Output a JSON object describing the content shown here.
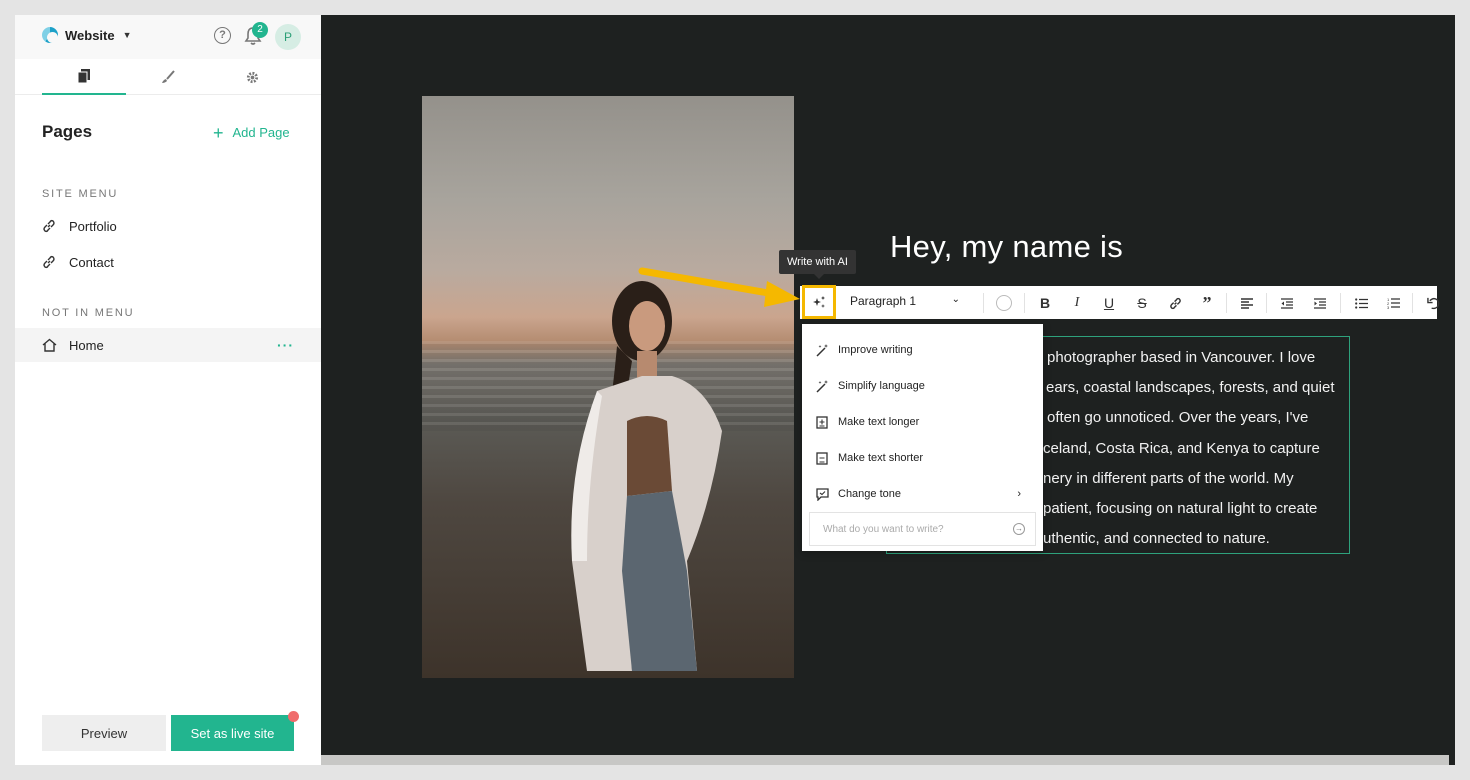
{
  "header": {
    "site_name": "Website",
    "notifications_count": "2",
    "avatar_initial": "P"
  },
  "tabs": [
    {
      "name": "pages",
      "icon": "pages-icon"
    },
    {
      "name": "design",
      "icon": "brush-icon"
    },
    {
      "name": "settings",
      "icon": "gear-icon"
    }
  ],
  "sidebar": {
    "title": "Pages",
    "add_page": "Add Page",
    "site_menu_label": "SITE MENU",
    "site_menu": [
      {
        "label": "Portfolio",
        "icon": "link-icon"
      },
      {
        "label": "Contact",
        "icon": "link-icon"
      }
    ],
    "not_in_menu_label": "NOT IN MENU",
    "not_in_menu": [
      {
        "label": "Home",
        "icon": "home-icon",
        "more": "···"
      }
    ],
    "preview_label": "Preview",
    "live_label": "Set as live site"
  },
  "canvas": {
    "headline": "Hey, my name is",
    "body_lines": [
      "photographer based in Vancouver. I love",
      "ears, coastal landscapes, forests, and quiet",
      "often go unnoticed. Over the years, I've",
      "celand, Costa Rica, and Kenya to capture",
      "nery in different parts of the world. My",
      "patient, focusing on natural light to create",
      "uthentic, and connected to nature."
    ]
  },
  "editor": {
    "tooltip": "Write with AI",
    "paragraph_style": "Paragraph 1",
    "toolbar_buttons": [
      "bold-icon",
      "italic-icon",
      "underline-icon",
      "strikethrough-icon",
      "link-icon",
      "quote-icon",
      "align-left-icon",
      "outdent-icon",
      "indent-icon",
      "bullet-list-icon",
      "numbered-list-icon",
      "undo-icon"
    ]
  },
  "ai_menu": {
    "items": [
      {
        "label": "Improve writing",
        "icon": "magic-wand-icon"
      },
      {
        "label": "Simplify language",
        "icon": "magic-wand-icon"
      },
      {
        "label": "Make text longer",
        "icon": "expand-text-icon"
      },
      {
        "label": "Make text shorter",
        "icon": "shrink-text-icon"
      },
      {
        "label": "Change tone",
        "icon": "chat-icon"
      }
    ],
    "prompt_placeholder": "What do you want to write?"
  },
  "colors": {
    "accent": "#22b58f",
    "highlight": "#f5b800",
    "canvas_bg": "#1e2120"
  }
}
